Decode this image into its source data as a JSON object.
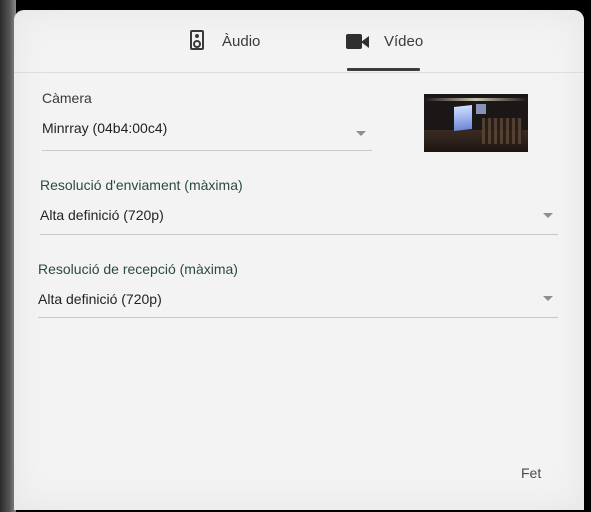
{
  "tabs": {
    "audio_label": "Àudio",
    "video_label": "Vídeo",
    "active": "video"
  },
  "video": {
    "camera": {
      "label": "Càmera",
      "value": "Minrray (04b4:00c4)"
    },
    "send_resolution": {
      "label": "Resolució d'enviament (màxima)",
      "value": "Alta definició (720p)"
    },
    "receive_resolution": {
      "label": "Resolució de recepció (màxima)",
      "value": "Alta definició (720p)"
    }
  },
  "footer": {
    "done_label": "Fet"
  },
  "icons": {
    "audio_tab": "speaker-icon",
    "video_tab": "videocam-icon",
    "dropdown": "dropdown-arrow-icon"
  },
  "colors": {
    "dialog_background": "#f3f3f3",
    "accent_label": "#2c4a42",
    "active_tab_indicator": "#3c3c3c"
  }
}
